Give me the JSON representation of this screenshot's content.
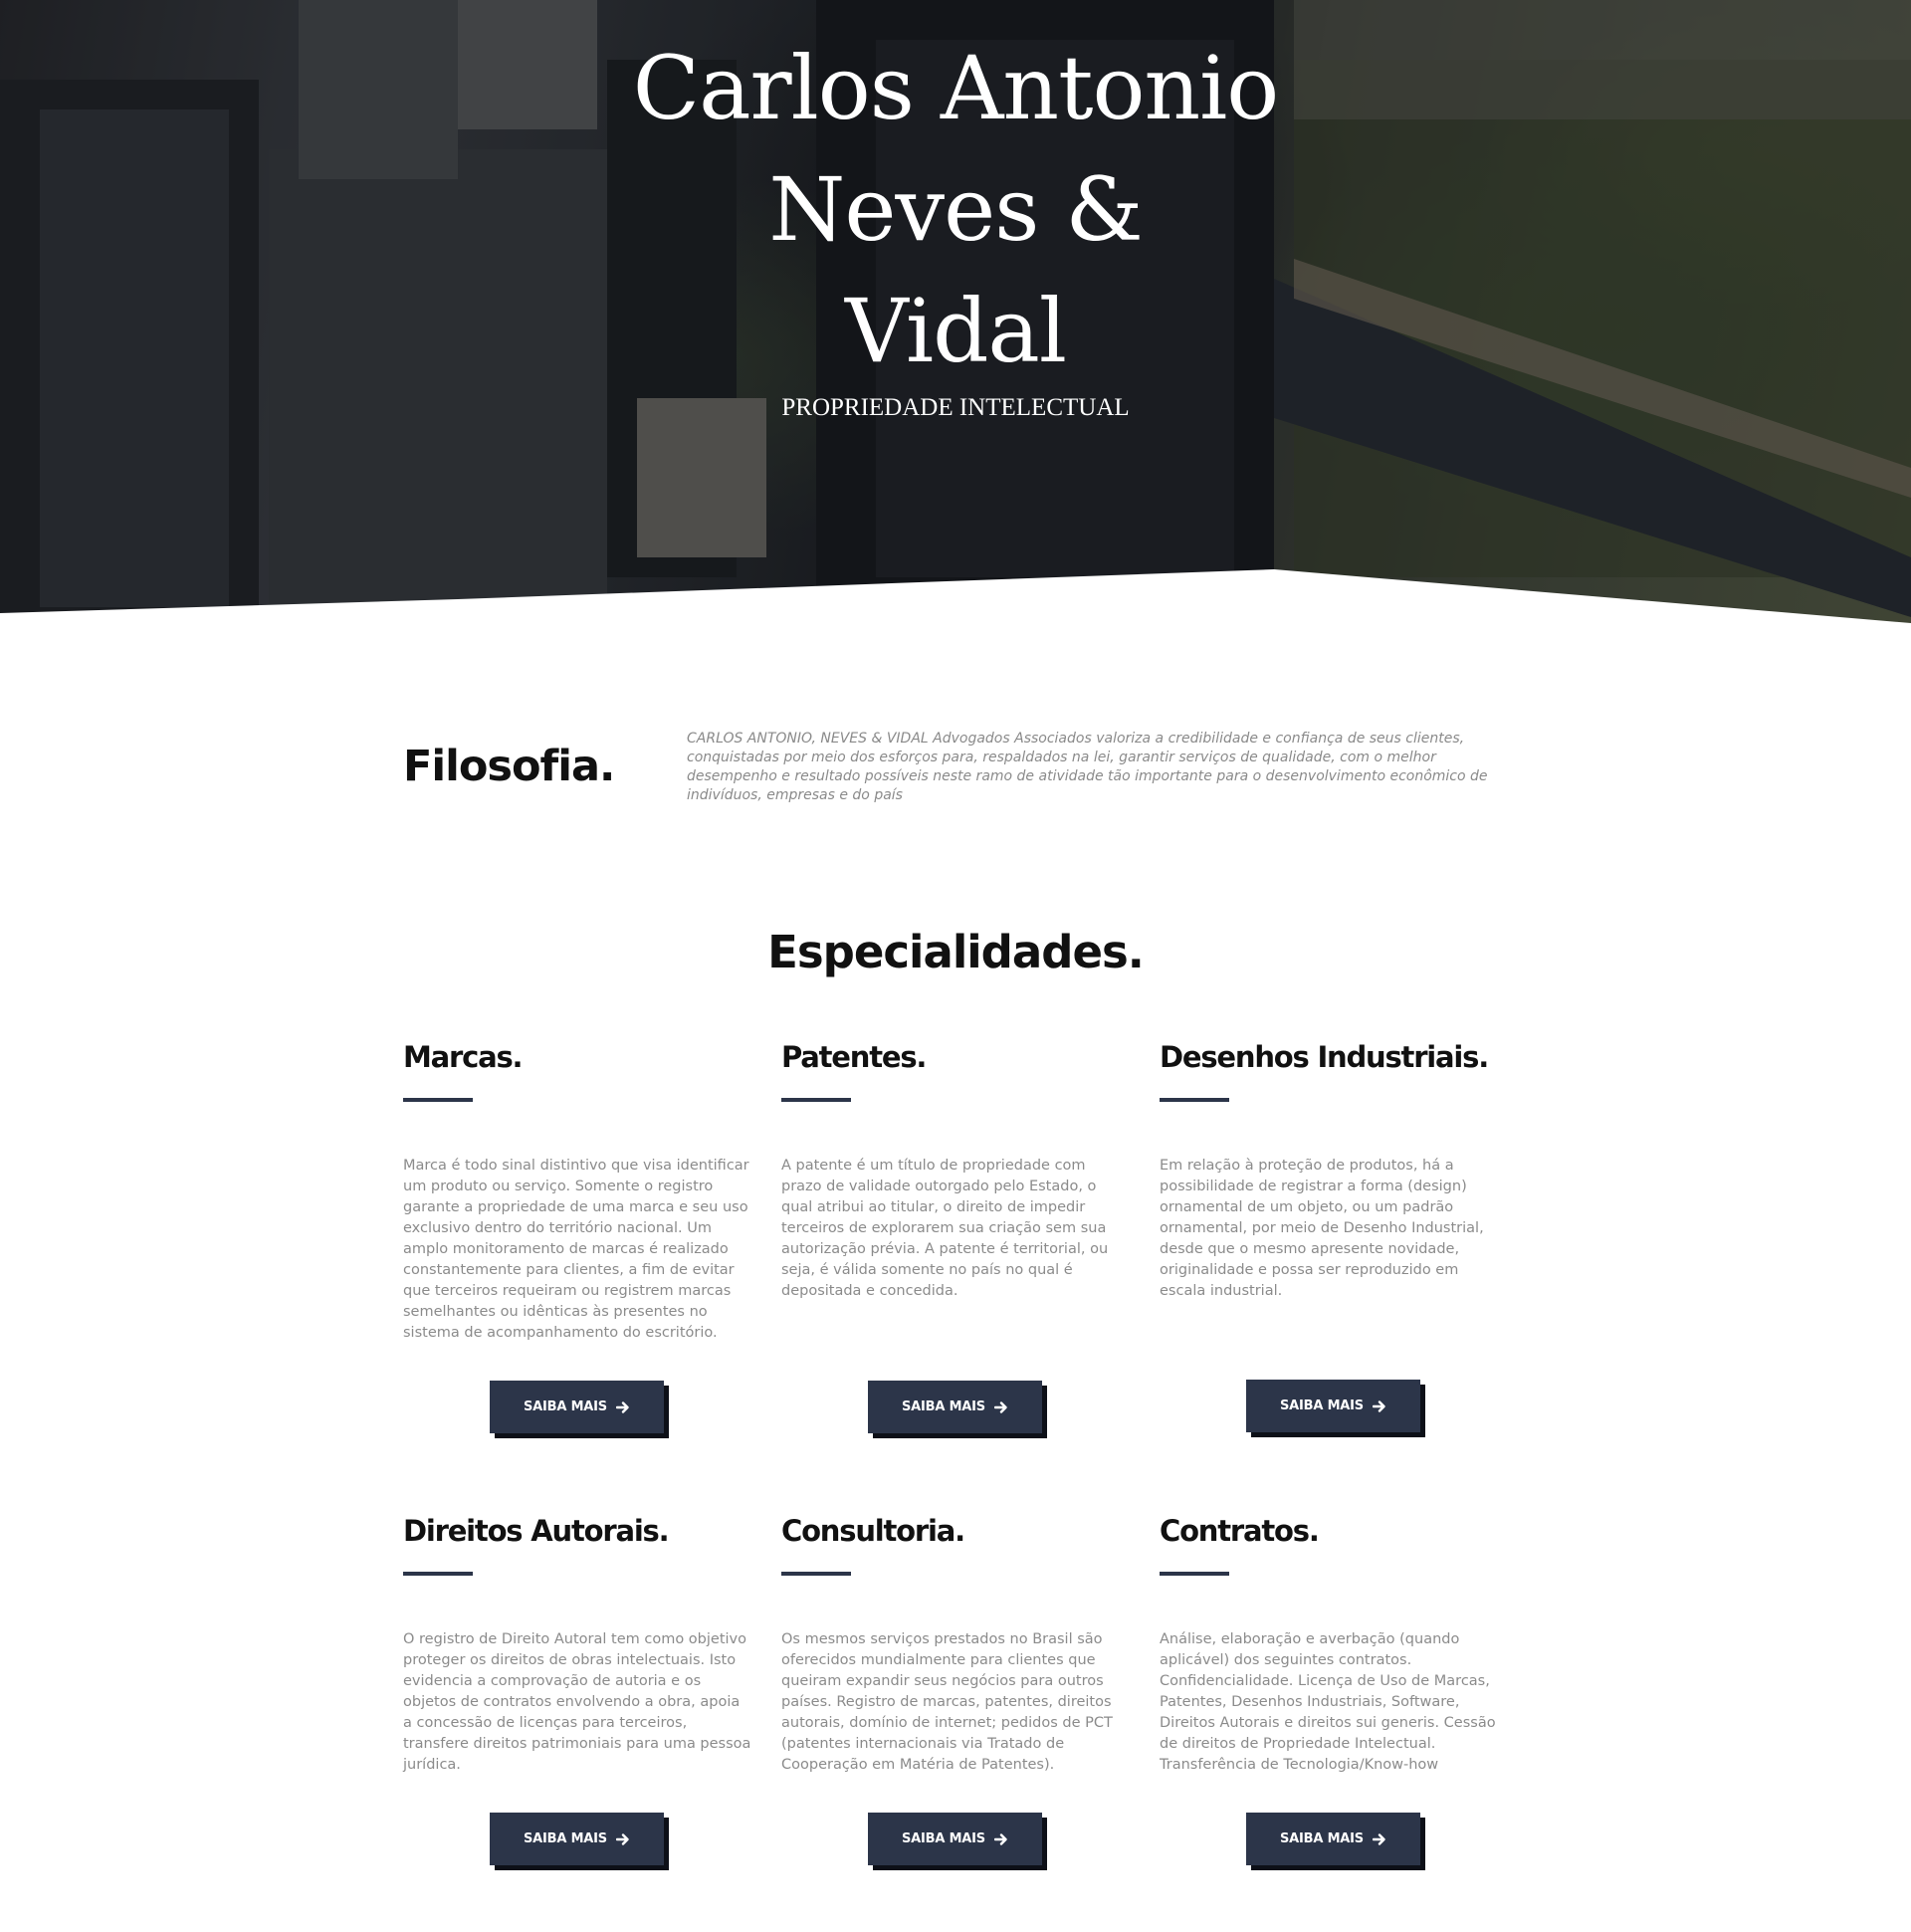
{
  "hero": {
    "title_lines": [
      "Carlos Antonio",
      "Neves &",
      "Vidal"
    ],
    "subtitle": "PROPRIEDADE INTELECTUAL"
  },
  "filosofia": {
    "heading": "Filosofia.",
    "text": "CARLOS ANTONIO, NEVES & VIDAL Advogados Associados valoriza a credibilidade e confiança de seus clientes, conquistadas por meio dos esforços para, respaldados na lei, garantir serviços de qualidade, com o melhor desempenho e resultado possíveis neste ramo de atividade tão importante para o desenvolvimento econômico de indivíduos, empresas e do país"
  },
  "especialidades": {
    "heading": "Especialidades.",
    "button_label": "SAIBA MAIS",
    "button_icon": "arrow-right-icon",
    "cards": [
      {
        "title": "Marcas.",
        "text": "Marca é todo sinal distintivo que visa identificar um produto ou serviço. Somente o registro garante a propriedade de uma marca e seu uso exclusivo dentro do território nacional. Um amplo monitoramento de marcas é realizado constantemente para clientes, a fim de evitar que terceiros requeiram ou registrem marcas semelhantes ou idênticas às presentes no sistema de acompanhamento do escritório."
      },
      {
        "title": "Patentes.",
        "text": "A patente é um título de propriedade com prazo de validade outorgado pelo Estado, o qual atribui ao titular, o direito de impedir terceiros de explorarem sua criação sem sua autorização prévia. A patente é territorial, ou seja, é válida somente no país no qual é depositada e concedida."
      },
      {
        "title": "Desenhos Industriais.",
        "text": "Em relação à proteção de produtos, há a possibilidade de registrar a forma (design) ornamental de um objeto, ou um padrão ornamental, por meio de Desenho Industrial, desde que o mesmo apresente novidade, originalidade e possa ser reproduzido em escala industrial."
      },
      {
        "title": "Direitos Autorais.",
        "text": "O registro de Direito Autoral tem como objetivo proteger os direitos de obras intelectuais. Isto evidencia a comprovação de autoria e os objetos de contratos envolvendo a obra, apoia a concessão de licenças para terceiros, transfere direitos patrimoniais para uma pessoa jurídica."
      },
      {
        "title": "Consultoria.",
        "text": "Os mesmos serviços prestados no Brasil são oferecidos mundialmente para clientes que queiram expandir seus negócios para outros países. Registro de marcas, patentes, direitos autorais, domínio de internet; pedidos de PCT (patentes internacionais via Tratado de Cooperação em Matéria de Patentes)."
      },
      {
        "title": "Contratos.",
        "text": "Análise, elaboração e averbação (quando aplicável) dos seguintes contratos. Confidencialidade. Licença de Uso de Marcas, Patentes, Desenhos Industriais, Software, Direitos Autorais e direitos sui generis. Cessão de direitos de Propriedade Intelectual. Transferência de Tecnologia/Know-how"
      }
    ]
  },
  "colors": {
    "accent": "#2c3549",
    "button_shadow": "#0d1018",
    "heading": "#111111",
    "body_text": "#8b8b8b"
  }
}
